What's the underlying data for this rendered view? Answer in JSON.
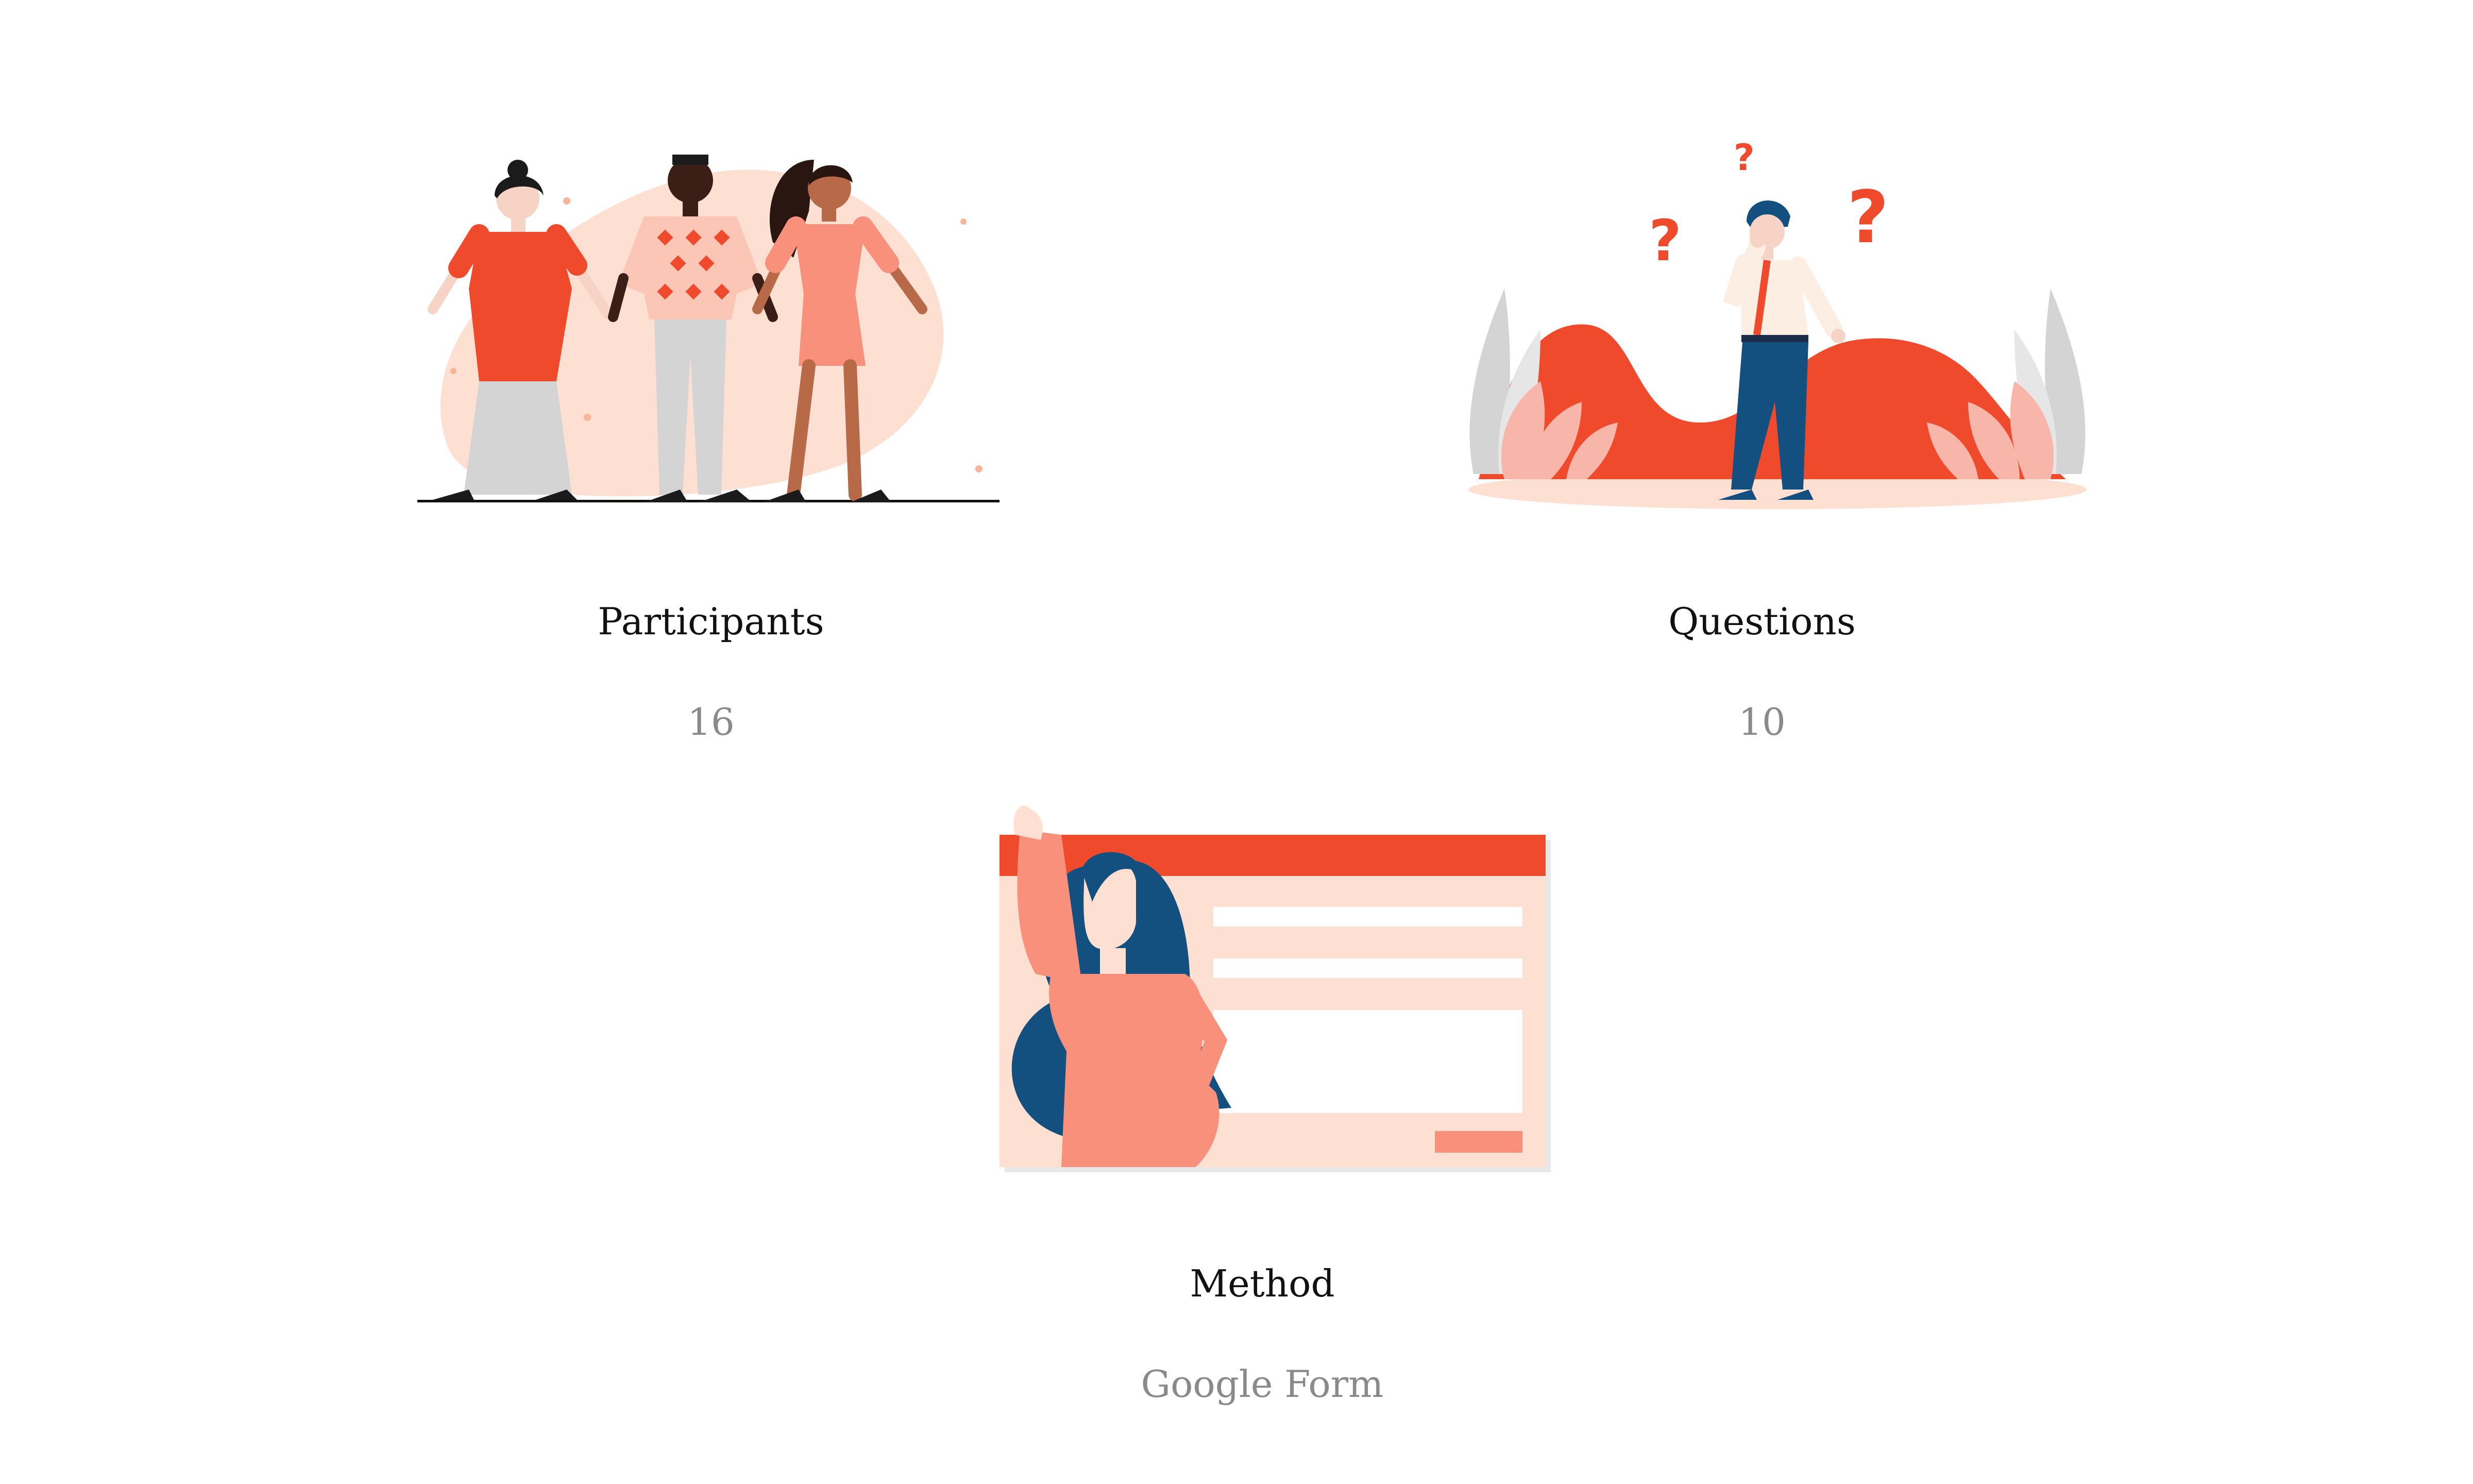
{
  "stats": [
    {
      "label": "Participants",
      "value": "16",
      "illustration": "three-people-holding-hands"
    },
    {
      "label": "Questions",
      "value": "10",
      "illustration": "confused-man-on-phone"
    },
    {
      "label": "Method",
      "value": "Google Form",
      "illustration": "woman-with-online-form"
    }
  ],
  "colors": {
    "accent": "#f04a2d",
    "salmon": "#f8907c",
    "peach": "#fde0d2",
    "navy": "#14507f",
    "label": "#111111",
    "value": "#8a8a8a"
  }
}
